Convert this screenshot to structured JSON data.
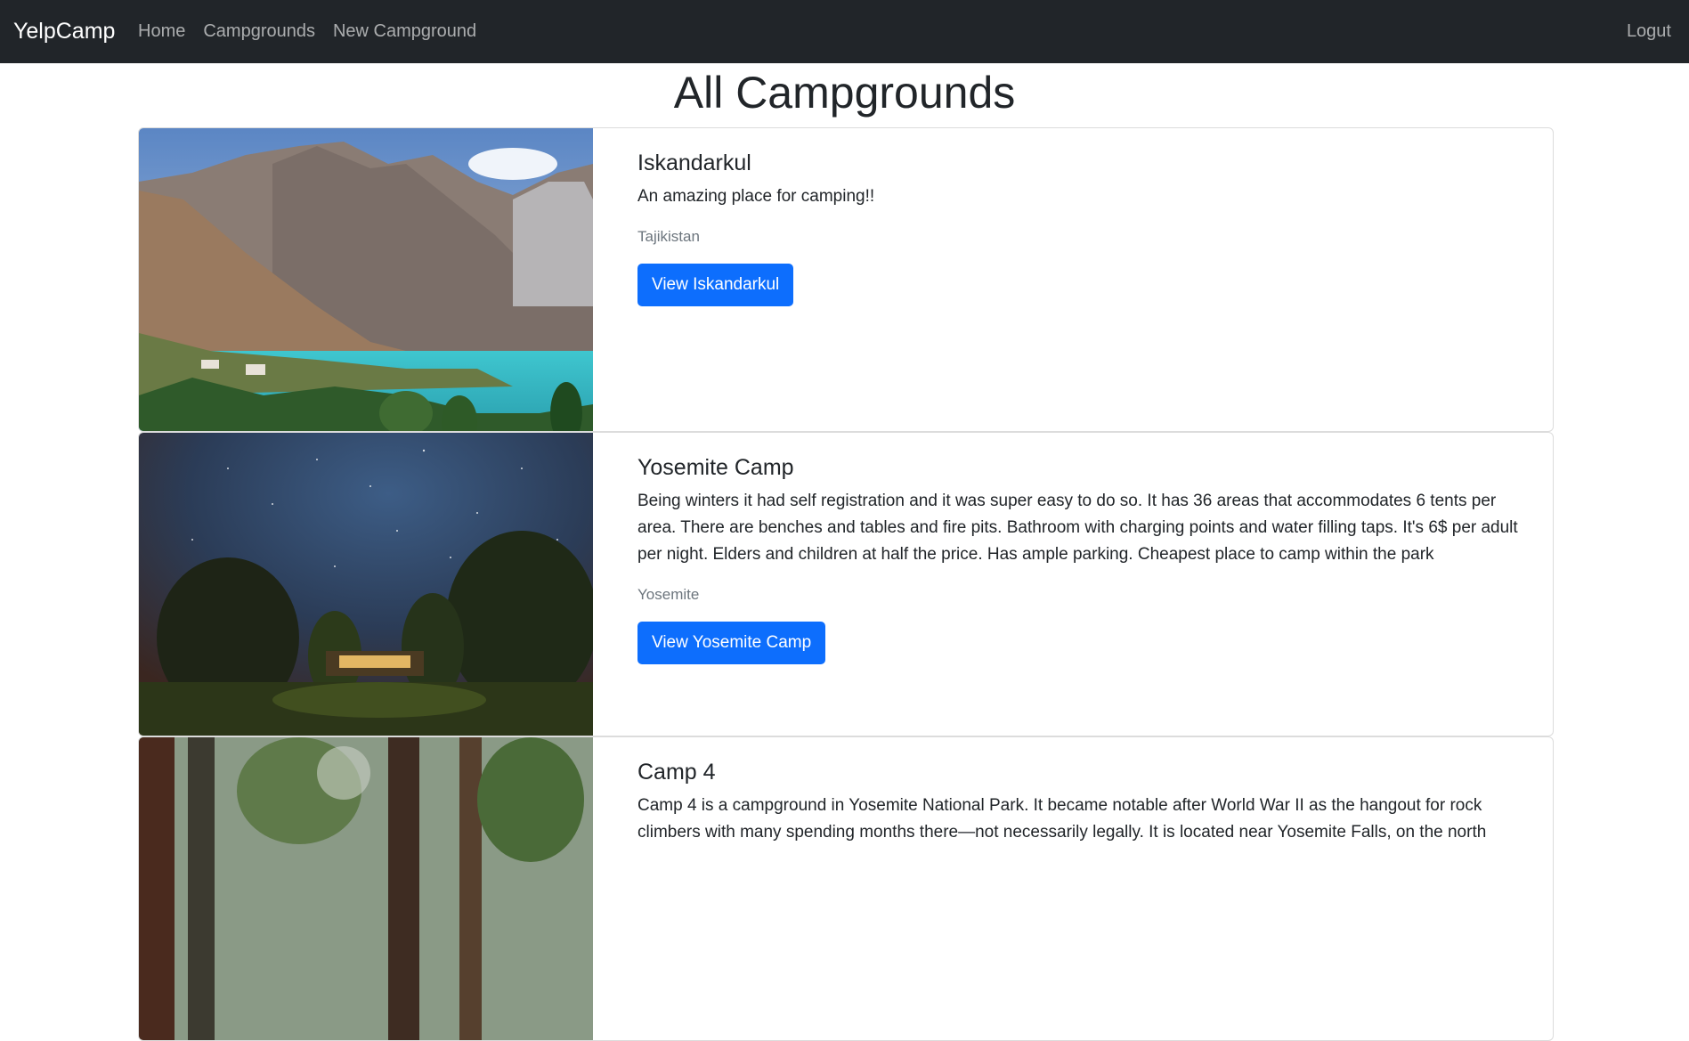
{
  "navbar": {
    "brand": "YelpCamp",
    "links": [
      "Home",
      "Campgrounds",
      "New Campground"
    ],
    "logout": "Logut",
    "background": "#212529"
  },
  "page": {
    "title": "All Campgrounds"
  },
  "campgrounds": [
    {
      "title": "Iskandarkul",
      "description": "An amazing place for camping!!",
      "location": "Tajikistan",
      "button": "View Iskandarkul"
    },
    {
      "title": "Yosemite Camp",
      "description": "Being winters it had self registration and it was super easy to do so. It has 36 areas that accommodates 6 tents per area. There are benches and tables and fire pits. Bathroom with charging points and water filling taps. It's 6$ per adult per night. Elders and children at half the price. Has ample parking. Cheapest place to camp within the park",
      "location": "Yosemite",
      "button": "View Yosemite Camp"
    },
    {
      "title": "Camp 4",
      "description": "Camp 4 is a campground in Yosemite National Park. It became notable after World War II as the hangout for rock climbers with many spending months there—not necessarily legally. It is located near Yosemite Falls, on the north",
      "location": "",
      "button": ""
    }
  ],
  "colors": {
    "primary": "#0d6efd",
    "muted": "#6c757d"
  }
}
